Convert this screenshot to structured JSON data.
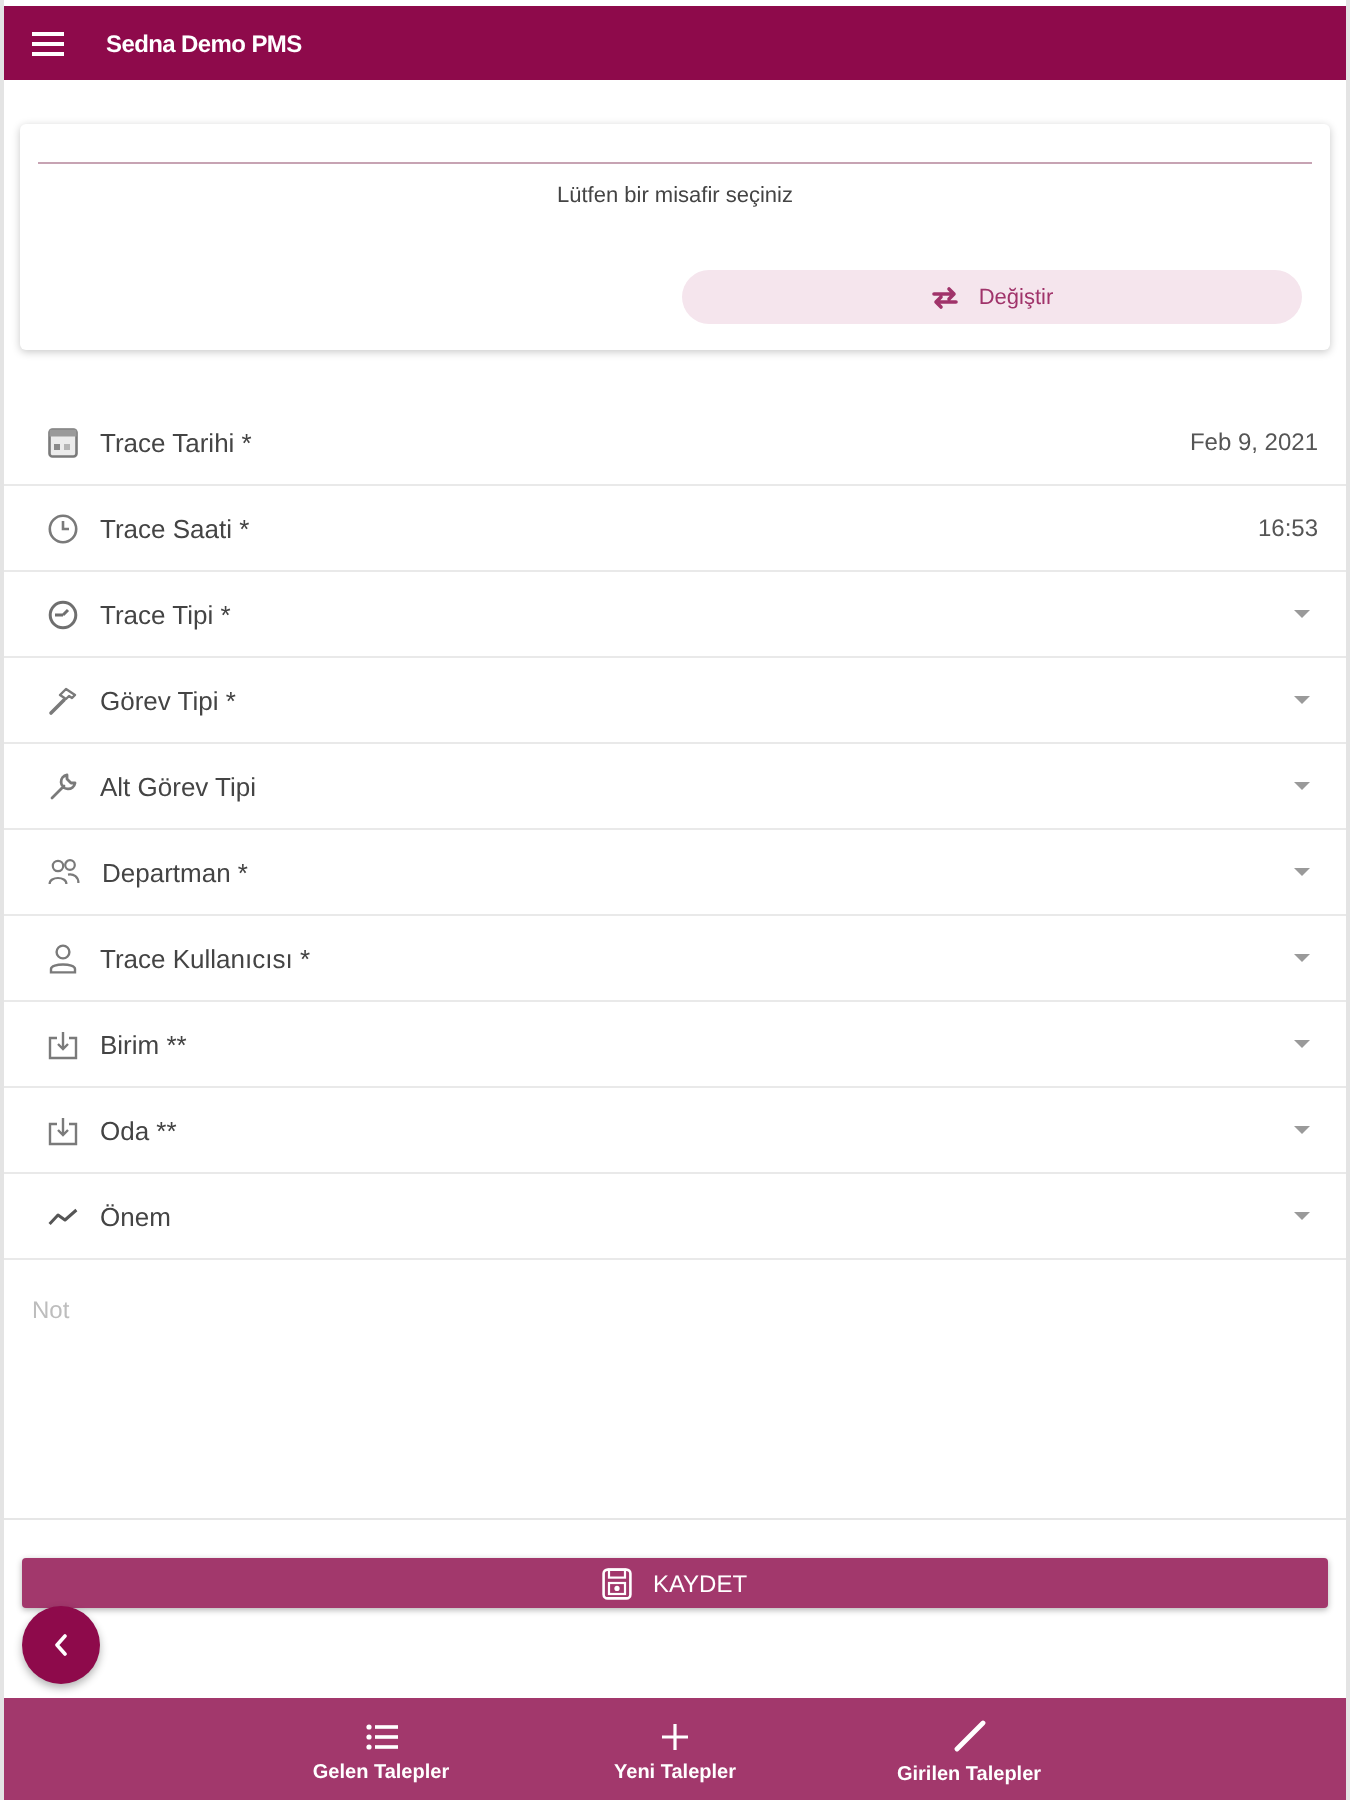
{
  "app_bar": {
    "title": "Sedna Demo PMS"
  },
  "guest_card": {
    "message": "Lütfen bir misafir seçiniz",
    "button": "Değiştir"
  },
  "fields": [
    {
      "kind": "value",
      "label": "Trace Tarihi *",
      "value": "Feb 9, 2021"
    },
    {
      "kind": "value",
      "label": "Trace Saati *",
      "value": "16:53"
    },
    {
      "kind": "dropdown",
      "label": "Trace Tipi *"
    },
    {
      "kind": "dropdown",
      "label": "Görev Tipi *"
    },
    {
      "kind": "dropdown",
      "label": "Alt Görev Tipi"
    },
    {
      "kind": "dropdown",
      "label": "Departman *"
    },
    {
      "kind": "dropdown",
      "label": "Trace Kullanıcısı *"
    },
    {
      "kind": "dropdown",
      "label": "Birim **"
    },
    {
      "kind": "dropdown",
      "label": "Oda **"
    },
    {
      "kind": "dropdown",
      "label": "Önem"
    }
  ],
  "note": {
    "placeholder": "Not"
  },
  "save_button": {
    "label": "KAYDET"
  },
  "bottom_nav": [
    {
      "label": "Gelen Talepler"
    },
    {
      "label": "Yeni Talepler"
    },
    {
      "label": "Girilen Talepler"
    }
  ]
}
